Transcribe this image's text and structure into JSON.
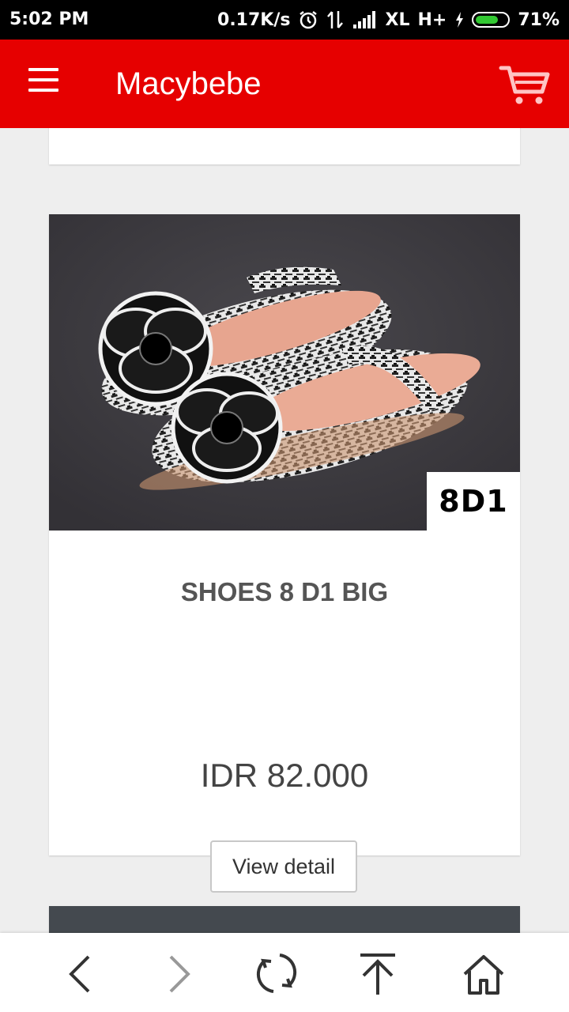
{
  "status_bar": {
    "time": "5:02 PM",
    "net_speed": "0.17K/s",
    "carrier": "XL",
    "network_type": "H+",
    "battery_percent": "71%",
    "battery_level": 0.71,
    "icons": [
      "alarm-icon",
      "data-transfer-icon",
      "signal-icon",
      "charging-icon",
      "battery-icon"
    ]
  },
  "app_bar": {
    "title": "Macybebe",
    "color": "#e60000",
    "icons": [
      "menu-icon",
      "cart-icon"
    ]
  },
  "product": {
    "sku_label": "8D1",
    "name": "SHOES 8 D1 BIG",
    "price": "IDR 82.000",
    "detail_button": "View detail"
  },
  "bottom_nav": {
    "icons": [
      "back-icon",
      "forward-icon",
      "refresh-icon",
      "scroll-top-icon",
      "home-icon"
    ]
  }
}
